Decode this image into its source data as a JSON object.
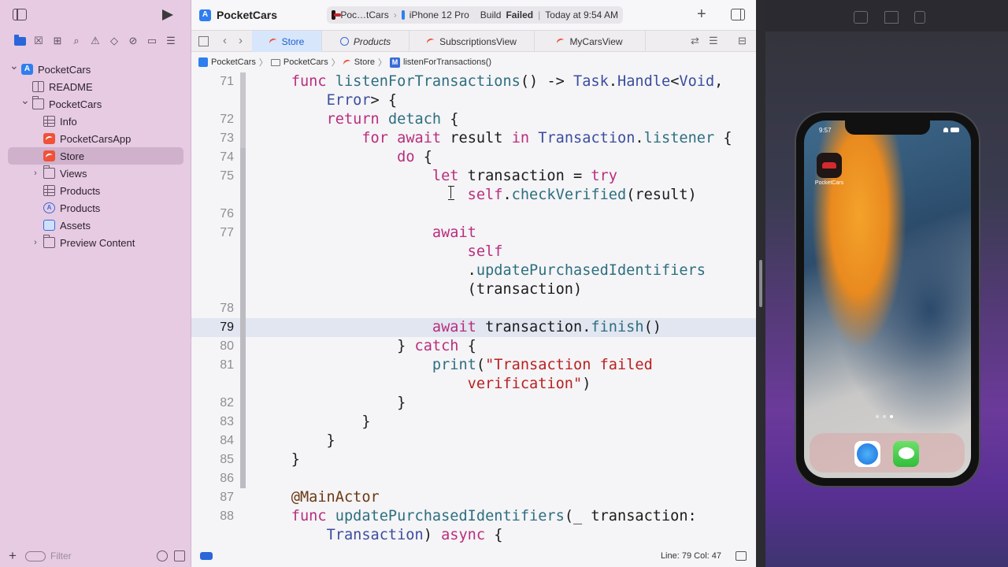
{
  "project": {
    "name": "PocketCars",
    "status": {
      "scheme": "Poc…tCars",
      "device": "iPhone 12 Pro",
      "build_prefix": "Build",
      "build_status": "Failed",
      "time": "Today at 9:54 AM"
    }
  },
  "sidebar": {
    "tree": [
      {
        "label": "PocketCars",
        "icon": "project-icon",
        "indent": 0,
        "chevron": "v"
      },
      {
        "label": "README",
        "icon": "book-icon",
        "indent": 1,
        "chevron": ""
      },
      {
        "label": "PocketCars",
        "icon": "folder-icon",
        "indent": 1,
        "chevron": "v"
      },
      {
        "label": "Info",
        "icon": "grid-icon",
        "indent": 2,
        "chevron": ""
      },
      {
        "label": "PocketCarsApp",
        "icon": "swift-icon",
        "indent": 2,
        "chevron": ""
      },
      {
        "label": "Store",
        "icon": "swift-icon",
        "indent": 2,
        "chevron": "",
        "selected": true
      },
      {
        "label": "Views",
        "icon": "folder-icon",
        "indent": 2,
        "chevron": ">"
      },
      {
        "label": "Products",
        "icon": "grid-icon",
        "indent": 2,
        "chevron": ""
      },
      {
        "label": "Products",
        "icon": "storekit-icon",
        "indent": 2,
        "chevron": ""
      },
      {
        "label": "Assets",
        "icon": "assets-icon",
        "indent": 2,
        "chevron": ""
      },
      {
        "label": "Preview Content",
        "icon": "folder-icon",
        "indent": 2,
        "chevron": ">"
      }
    ],
    "filter_placeholder": "Filter"
  },
  "tabs": [
    {
      "label": "Store",
      "icon": "swift-icon",
      "active": true,
      "italic": false
    },
    {
      "label": "Products",
      "icon": "storekit-icon",
      "active": false,
      "italic": true
    },
    {
      "label": "SubscriptionsView",
      "icon": "swift-icon",
      "active": false,
      "italic": false
    },
    {
      "label": "MyCarsView",
      "icon": "swift-icon",
      "active": false,
      "italic": false
    }
  ],
  "breadcrumb": [
    "PocketCars",
    "PocketCars",
    "Store",
    "listenForTransactions()"
  ],
  "code": {
    "current_line": 79,
    "lines": [
      {
        "num": "71",
        "tokens": [
          [
            "",
            "    "
          ],
          [
            "kw",
            "func"
          ],
          [
            "",
            " "
          ],
          [
            "fn",
            "listenForTransactions"
          ],
          [
            "",
            "() -> "
          ],
          [
            "ty",
            "Task"
          ],
          [
            "",
            "."
          ],
          [
            "ty",
            "Handle"
          ],
          [
            "",
            "<"
          ],
          [
            "ty",
            "Void"
          ],
          [
            "",
            ","
          ]
        ]
      },
      {
        "num": "",
        "tokens": [
          [
            "",
            "        "
          ],
          [
            "ty",
            "Error"
          ],
          [
            "",
            "> {"
          ]
        ]
      },
      {
        "num": "72",
        "tokens": [
          [
            "",
            "        "
          ],
          [
            "kw",
            "return"
          ],
          [
            "",
            " "
          ],
          [
            "fn",
            "detach"
          ],
          [
            "",
            " {"
          ]
        ]
      },
      {
        "num": "73",
        "tokens": [
          [
            "",
            "            "
          ],
          [
            "kw",
            "for"
          ],
          [
            "",
            " "
          ],
          [
            "kw",
            "await"
          ],
          [
            "",
            " result "
          ],
          [
            "kw",
            "in"
          ],
          [
            "",
            " "
          ],
          [
            "ty",
            "Transaction"
          ],
          [
            "",
            "."
          ],
          [
            "fn",
            "listener"
          ],
          [
            "",
            " {"
          ]
        ]
      },
      {
        "num": "74",
        "tokens": [
          [
            "",
            "                "
          ],
          [
            "kw",
            "do"
          ],
          [
            "",
            " {"
          ]
        ]
      },
      {
        "num": "75",
        "tokens": [
          [
            "",
            "                    "
          ],
          [
            "kw",
            "let"
          ],
          [
            "",
            " transaction = "
          ],
          [
            "kw",
            "try"
          ]
        ]
      },
      {
        "num": "",
        "tokens": [
          [
            "",
            "                        "
          ],
          [
            "kw",
            "self"
          ],
          [
            "",
            "."
          ],
          [
            "fn",
            "checkVerified"
          ],
          [
            "",
            "(result)"
          ]
        ]
      },
      {
        "num": "76",
        "tokens": [
          [
            "",
            ""
          ]
        ]
      },
      {
        "num": "77",
        "tokens": [
          [
            "",
            "                    "
          ],
          [
            "kw",
            "await"
          ]
        ]
      },
      {
        "num": "",
        "tokens": [
          [
            "",
            "                        "
          ],
          [
            "kw",
            "self"
          ]
        ]
      },
      {
        "num": "",
        "tokens": [
          [
            "",
            "                        ."
          ],
          [
            "fn",
            "updatePurchasedIdentifiers"
          ]
        ]
      },
      {
        "num": "",
        "tokens": [
          [
            "",
            "                        (transaction)"
          ]
        ]
      },
      {
        "num": "78",
        "tokens": [
          [
            "",
            ""
          ]
        ]
      },
      {
        "num": "79",
        "tokens": [
          [
            "",
            "                    "
          ],
          [
            "kw",
            "await"
          ],
          [
            "",
            " transaction."
          ],
          [
            "fn",
            "finish"
          ],
          [
            "",
            "()"
          ]
        ]
      },
      {
        "num": "80",
        "tokens": [
          [
            "",
            "                } "
          ],
          [
            "kw",
            "catch"
          ],
          [
            "",
            " {"
          ]
        ]
      },
      {
        "num": "81",
        "tokens": [
          [
            "",
            "                    "
          ],
          [
            "fn",
            "print"
          ],
          [
            "",
            "("
          ],
          [
            "str",
            "\"Transaction failed"
          ]
        ]
      },
      {
        "num": "",
        "tokens": [
          [
            "",
            "                        "
          ],
          [
            "str",
            "verification\""
          ],
          [
            "",
            ")"
          ]
        ]
      },
      {
        "num": "82",
        "tokens": [
          [
            "",
            "                }"
          ]
        ]
      },
      {
        "num": "83",
        "tokens": [
          [
            "",
            "            }"
          ]
        ]
      },
      {
        "num": "84",
        "tokens": [
          [
            "",
            "        }"
          ]
        ]
      },
      {
        "num": "85",
        "tokens": [
          [
            "",
            "    }"
          ]
        ]
      },
      {
        "num": "86",
        "tokens": [
          [
            "",
            ""
          ]
        ]
      },
      {
        "num": "87",
        "tokens": [
          [
            "",
            "    "
          ],
          [
            "at",
            "@MainActor"
          ]
        ]
      },
      {
        "num": "88",
        "tokens": [
          [
            "",
            "    "
          ],
          [
            "kw",
            "func"
          ],
          [
            "",
            " "
          ],
          [
            "fn",
            "updatePurchasedIdentifiers"
          ],
          [
            "",
            "(_ transaction:"
          ]
        ]
      },
      {
        "num": "",
        "tokens": [
          [
            "",
            "        "
          ],
          [
            "ty",
            "Transaction"
          ],
          [
            "",
            ") "
          ],
          [
            "kw",
            "async"
          ],
          [
            "",
            " {"
          ]
        ]
      }
    ]
  },
  "statusbar": {
    "line_col": "Line: 79  Col: 47"
  },
  "simulator": {
    "time": "9:57",
    "app_label": "PocketCars",
    "dock": [
      "safari-icon",
      "messages-icon"
    ]
  },
  "colors": {
    "sidebar_bg": "#e6cbe3",
    "keyword": "#b82e7e",
    "function": "#2d6f80",
    "type": "#3a4e9e",
    "string": "#b82121",
    "accent": "#2a66d9"
  }
}
